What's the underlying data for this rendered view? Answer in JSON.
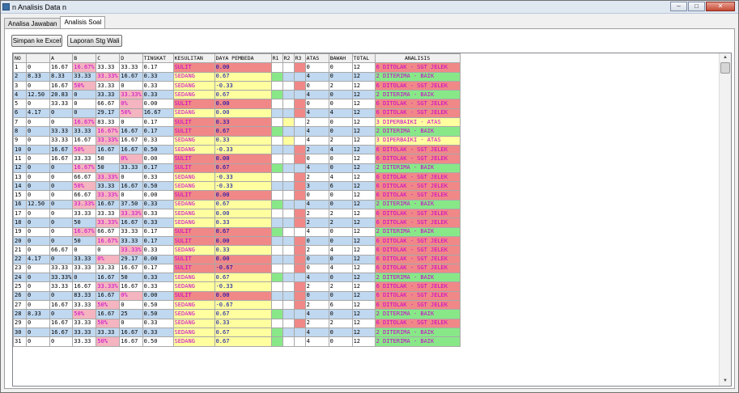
{
  "window": {
    "title": "n Analisis Data n",
    "btn_min": "–",
    "btn_max": "□",
    "btn_close": "✕"
  },
  "tabs": [
    {
      "label": "Analisa Jawaban"
    },
    {
      "label": "Analisis Soal"
    }
  ],
  "toolbar": {
    "save_label": "Simpan ke Excel",
    "report_label": "Laporan Stg Wali"
  },
  "table": {
    "columns": [
      "NO",
      "",
      "A",
      "B",
      "C",
      "D",
      "TINGKAT",
      "KESULITAN",
      "DAYA PEMBEDA",
      "R1",
      "R2",
      "R3",
      "ATAS",
      "BAWAH",
      "TOTAL",
      "ANALISIS"
    ],
    "rows": [
      {
        "c": [
          "1",
          "0",
          "16.67",
          "16.67%",
          "33.33",
          "33.33",
          "0.17",
          "SULIT",
          "0.00",
          "",
          "",
          "",
          "0",
          "0",
          "12",
          "6 DITOLAK - SGT JELEK"
        ]
      },
      {
        "c": [
          "2",
          "8.33",
          "8.33",
          "33.33",
          "33.33%",
          "16.67",
          "0.33",
          "SEDANG",
          "0.67",
          "",
          "",
          "",
          "4",
          "0",
          "12",
          "2 DITERIMA - BAIK"
        ]
      },
      {
        "c": [
          "3",
          "0",
          "16.67",
          "50%",
          "33.33",
          "0",
          "0.33",
          "SEDANG",
          "-0.33",
          "",
          "",
          "",
          "0",
          "2",
          "12",
          "6 DITOLAK - SGT JELEK"
        ]
      },
      {
        "c": [
          "4",
          "12.50",
          "20.83",
          "0",
          "33.33",
          "33.33%",
          "0.33",
          "SEDANG",
          "0.67",
          "",
          "",
          "",
          "4",
          "0",
          "12",
          "2 DITERIMA - BAIK"
        ]
      },
      {
        "c": [
          "5",
          "0",
          "33.33",
          "0",
          "66.67",
          "0%",
          "0.00",
          "SULIT",
          "0.00",
          "",
          "",
          "",
          "0",
          "0",
          "12",
          "6 DITOLAK - SGT JELEK"
        ]
      },
      {
        "c": [
          "6",
          "4.17",
          "0",
          "0",
          "29.17",
          "50%",
          "16.67",
          "SEDANG",
          "0.00",
          "",
          "",
          "",
          "4",
          "4",
          "12",
          "6 DITOLAK - SGT JELEK"
        ]
      },
      {
        "c": [
          "7",
          "0",
          "0",
          "16.67%",
          "83.33",
          "0",
          "0.17",
          "SULIT",
          "0.33",
          "",
          "",
          "",
          "2",
          "0",
          "12",
          "3 DIPERBAIKI - ATAS"
        ]
      },
      {
        "c": [
          "8",
          "0",
          "33.33",
          "33.33",
          "16.67%",
          "16.67",
          "0.17",
          "SULIT",
          "0.67",
          "",
          "",
          "",
          "4",
          "0",
          "12",
          "2 DITERIMA - BAIK"
        ]
      },
      {
        "c": [
          "9",
          "0",
          "33.33",
          "16.67",
          "33.33%",
          "16.67",
          "0.33",
          "SEDANG",
          "0.33",
          "",
          "",
          "",
          "4",
          "2",
          "12",
          "3 DIPERBAIKI - ATAS"
        ]
      },
      {
        "c": [
          "10",
          "0",
          "16.67",
          "50%",
          "16.67",
          "16.67",
          "0.50",
          "SEDANG",
          "-0.33",
          "",
          "",
          "",
          "2",
          "4",
          "12",
          "6 DITOLAK - SGT JELEK"
        ]
      },
      {
        "c": [
          "11",
          "0",
          "16.67",
          "33.33",
          "50",
          "0%",
          "0.00",
          "SULIT",
          "0.00",
          "",
          "",
          "",
          "0",
          "0",
          "12",
          "6 DITOLAK - SGT JELEK"
        ]
      },
      {
        "c": [
          "12",
          "0",
          "0",
          "16.67%",
          "50",
          "33.33",
          "0.17",
          "SULIT",
          "0.67",
          "",
          "",
          "",
          "4",
          "0",
          "12",
          "2 DITERIMA - BAIK"
        ]
      },
      {
        "c": [
          "13",
          "0",
          "0",
          "66.67",
          "33.33%",
          "0",
          "0.33",
          "SEDANG",
          "-0.33",
          "",
          "",
          "",
          "2",
          "4",
          "12",
          "6 DITOLAK - SGT JELEK"
        ]
      },
      {
        "c": [
          "14",
          "0",
          "0",
          "50%",
          "33.33",
          "16.67",
          "0.50",
          "SEDANG",
          "-0.33",
          "",
          "",
          "",
          "3",
          "6",
          "12",
          "6 DITOLAK - SGT JELEK"
        ]
      },
      {
        "c": [
          "15",
          "0",
          "0",
          "66.67",
          "33.33%",
          "0",
          "0.00",
          "SULIT",
          "0.00",
          "",
          "",
          "",
          "0",
          "0",
          "12",
          "6 DITOLAK - SGT JELEK"
        ]
      },
      {
        "c": [
          "16",
          "12.50",
          "0",
          "33.33%",
          "16.67",
          "37.50",
          "0.33",
          "SEDANG",
          "0.67",
          "",
          "",
          "",
          "4",
          "0",
          "12",
          "2 DITERIMA - BAIK"
        ]
      },
      {
        "c": [
          "17",
          "0",
          "0",
          "33.33",
          "33.33",
          "33.33%",
          "0.33",
          "SEDANG",
          "0.00",
          "",
          "",
          "",
          "2",
          "2",
          "12",
          "6 DITOLAK - SGT JELEK"
        ]
      },
      {
        "c": [
          "18",
          "0",
          "0",
          "50",
          "33.33%",
          "16.67",
          "0.33",
          "SEDANG",
          "0.33",
          "",
          "",
          "",
          "2",
          "2",
          "12",
          "6 DITOLAK - SGT JELEK"
        ]
      },
      {
        "c": [
          "19",
          "0",
          "0",
          "16.67%",
          "66.67",
          "33.33",
          "0.17",
          "SULIT",
          "0.67",
          "",
          "",
          "",
          "4",
          "0",
          "12",
          "2 DITERIMA - BAIK"
        ]
      },
      {
        "c": [
          "20",
          "0",
          "0",
          "50",
          "16.67%",
          "33.33",
          "0.17",
          "SULIT",
          "0.00",
          "",
          "",
          "",
          "0",
          "0",
          "12",
          "6 DITOLAK - SGT JELEK"
        ]
      },
      {
        "c": [
          "21",
          "0",
          "66.67",
          "0",
          "0",
          "33.33%",
          "0.33",
          "SEDANG",
          "0.33",
          "",
          "",
          "",
          "2",
          "4",
          "12",
          "6 DITOLAK - SGT JELEK"
        ]
      },
      {
        "c": [
          "22",
          "4.17",
          "0",
          "33.33",
          "0%",
          "29.17",
          "0.00",
          "SULIT",
          "0.00",
          "",
          "",
          "",
          "0",
          "0",
          "12",
          "6 DITOLAK - SGT JELEK"
        ]
      },
      {
        "c": [
          "23",
          "0",
          "33.33",
          "33.33",
          "33.33",
          "16.67",
          "0.17",
          "SULIT",
          "-0.67",
          "",
          "",
          "",
          "0",
          "4",
          "12",
          "6 DITOLAK - SGT JELEK"
        ]
      },
      {
        "c": [
          "24",
          "0",
          "33.33%",
          "0",
          "16.67",
          "50",
          "0.33",
          "SEDANG",
          "0.67",
          "",
          "",
          "",
          "4",
          "0",
          "12",
          "2 DITERIMA - BAIK"
        ]
      },
      {
        "c": [
          "25",
          "0",
          "33.33",
          "16.67",
          "33.33%",
          "16.67",
          "0.33",
          "SEDANG",
          "-0.33",
          "",
          "",
          "",
          "2",
          "2",
          "12",
          "6 DITOLAK - SGT JELEK"
        ]
      },
      {
        "c": [
          "26",
          "0",
          "0",
          "83.33",
          "16.67",
          "0%",
          "0.00",
          "SULIT",
          "0.00",
          "",
          "",
          "",
          "0",
          "0",
          "12",
          "6 DITOLAK - SGT JELEK"
        ]
      },
      {
        "c": [
          "27",
          "0",
          "16.67",
          "33.33",
          "50%",
          "0",
          "0.50",
          "SEDANG",
          "-0.67",
          "",
          "",
          "",
          "2",
          "6",
          "12",
          "6 DITOLAK - SGT JELEK"
        ]
      },
      {
        "c": [
          "28",
          "8.33",
          "0",
          "50%",
          "16.67",
          "25",
          "0.50",
          "SEDANG",
          "0.67",
          "",
          "",
          "",
          "4",
          "0",
          "12",
          "2 DITERIMA - BAIK"
        ]
      },
      {
        "c": [
          "29",
          "0",
          "16.67",
          "33.33",
          "50%",
          "0",
          "0.33",
          "SEDANG",
          "0.33",
          "",
          "",
          "",
          "2",
          "2",
          "12",
          "6 DITOLAK - SGT JELEK"
        ]
      },
      {
        "c": [
          "30",
          "0",
          "16.67",
          "33.33",
          "33.33",
          "16.67",
          "0.33",
          "SEDANG",
          "0.67",
          "",
          "",
          "",
          "4",
          "0",
          "12",
          "2 DITERIMA - BAIK"
        ]
      },
      {
        "c": [
          "31",
          "0",
          "0",
          "33.33",
          "50%",
          "16.67",
          "0.50",
          "SEDANG",
          "0.67",
          "",
          "",
          "",
          "4",
          "0",
          "12",
          "2 DITERIMA - BAIK"
        ]
      }
    ]
  },
  "colors": {
    "row_even": "#c0d8f0",
    "row_odd": "#ffffff",
    "pink": "#f08888",
    "light_pink": "#f4b4c0",
    "yellow": "#ffffa0",
    "green": "#88e888",
    "magenta": "#cc00cc",
    "blue_text": "#0000aa"
  }
}
